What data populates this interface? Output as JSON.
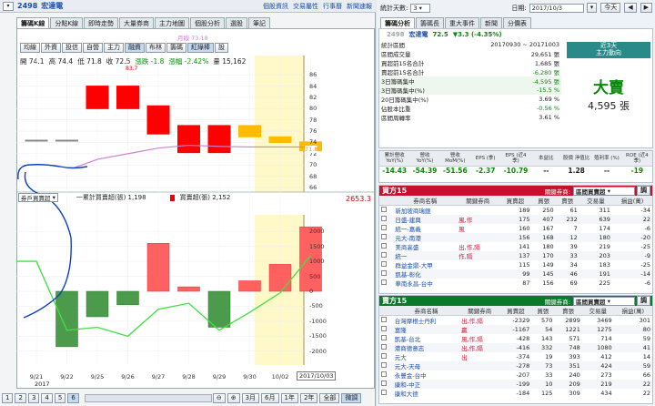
{
  "stock": {
    "code": "2498",
    "name": "宏達電",
    "price": "72.5",
    "change": "▼3.3 (-4.35%)"
  },
  "top_links": [
    "個股資訊",
    "交易屬性",
    "行事曆",
    "新聞速報"
  ],
  "left_tabs": [
    "籌碼K線",
    "分點K線",
    "即時走勢",
    "大量券商",
    "主力地圖",
    "個股分析",
    "選股",
    "筆記"
  ],
  "chart_buttons": [
    "均線",
    "外資",
    "投信",
    "自營",
    "主力",
    "融資",
    "布林",
    "籌碼",
    "紅綠棒",
    "設"
  ],
  "ohlc": {
    "open": "開 74.1",
    "high": "高 74.4",
    "low": "低 71.8",
    "close": "收 72.5",
    "chg": "漲跌 -1.8",
    "pct": "漲幅 -2.42%",
    "vol": "量 15,162"
  },
  "ma_label": "月線 73.18",
  "upper_marks": {
    "price_high": "83.7",
    "price_low": "71.8"
  },
  "price_axis": [
    "86",
    "84",
    "82",
    "80",
    "78",
    "76",
    "74",
    "72",
    "70",
    "68",
    "66"
  ],
  "lower_header": {
    "select": "券戶買賣超",
    "series1": "一累計買賣超(張) 1,198",
    "series2": "買賣超(張) 2,152",
    "right_value": "2653.3"
  },
  "lower_axis": [
    "2000",
    "1500",
    "1000",
    "500",
    "0",
    "-500",
    "-1000",
    "-1500",
    "-2000"
  ],
  "chart_data": {
    "type": "bar",
    "categories": [
      "9/21",
      "9/22",
      "9/25",
      "9/26",
      "9/27",
      "9/28",
      "9/29",
      "9/30",
      "10/02",
      "10/03"
    ],
    "candles": [
      {
        "o": 74.4,
        "c": 74.4
      },
      {
        "o": 74.4,
        "c": 74.4
      },
      {
        "o": 80,
        "c": 84
      },
      {
        "o": 80,
        "c": 84
      },
      {
        "o": 75.5,
        "c": 80.5
      },
      {
        "o": 72.2,
        "c": 77
      },
      {
        "o": 72.2,
        "c": 77
      },
      {
        "o": 77,
        "c": 75
      },
      {
        "o": 75,
        "c": 74
      },
      {
        "o": 74.1,
        "c": 72.5
      }
    ],
    "candle_colors": [
      "#888888",
      "#888888",
      "#ff0000",
      "#ff0000",
      "#ff0000",
      "#ff0000",
      "#ff0000",
      "#ffbb00",
      "#ffbb00",
      "#ffbb00"
    ],
    "ma": [
      null,
      null,
      71,
      72,
      73,
      73.5,
      73.3,
      73.2,
      73.2,
      73.18
    ],
    "ylim_price": [
      66,
      87
    ],
    "net_buy": [
      0,
      -1850,
      -850,
      -450,
      1600,
      150,
      -1200,
      350,
      900,
      2152
    ],
    "cumulative": [
      1000,
      -1300,
      -1200,
      -1500,
      -600,
      -400,
      -1300,
      -700,
      -50,
      1198
    ],
    "ylim_vol": [
      -2400,
      2400
    ],
    "xlabel_year": "2017",
    "selected_date": "2017/10/03"
  },
  "bottom_bar": {
    "pages": [
      "1",
      "2",
      "3",
      "4",
      "5",
      "6"
    ],
    "active_page": "6",
    "ranges": [
      "3月",
      "6月",
      "1年",
      "2年",
      "全部",
      "微調"
    ]
  },
  "right_top": {
    "days_label": "統計天數:",
    "days_value": "3",
    "date_label": "日期:",
    "date_value": "2017/10/3",
    "today_btn": "今天"
  },
  "right_tabs": [
    "籌碼分析",
    "籌碼長",
    "重大事件",
    "新聞",
    "分價表"
  ],
  "stats": {
    "rows": [
      {
        "label": "統計區間",
        "value": "20170930 ~ 20171003"
      },
      {
        "label": "區間成交量",
        "value": "29,651 張"
      },
      {
        "label": "買超前15名合計",
        "value": "1,685 張"
      },
      {
        "label": "賣超前15名合計",
        "value": "-6,280 張"
      },
      {
        "label": "3日籌碼集中",
        "value": "-4,595 張"
      },
      {
        "label": "3日籌碼集中(%)",
        "value": "-15.5 %"
      },
      {
        "label": "20日籌碼集中(%)",
        "value": "3.69 %"
      },
      {
        "label": "佔股本比重",
        "value": "-0.56 %"
      },
      {
        "label": "區間周轉率",
        "value": "3.61 %"
      }
    ],
    "trend_title": "近3天",
    "trend_sub": "主力動向",
    "verdict": "大賣",
    "verdict_amt": "4,595 張"
  },
  "fund": {
    "headers": [
      "累計營收 YoY(%)",
      "營收 YoY(%)",
      "營收 MoM(%)",
      "EPS (季)",
      "EPS (近4季)",
      "本益比",
      "股價 淨值比",
      "殖利率 (%)",
      "ROE (近4季)"
    ],
    "values": [
      "-14.43",
      "-54.39",
      "-51.56",
      "-2.37",
      "-10.79",
      "--",
      "1.28",
      "--",
      "-19"
    ]
  },
  "buy_section": {
    "title": "買方15",
    "hint": "關鍵券商:",
    "select": "區間買賣超",
    "btn": "調",
    "headers": [
      "券商名稱",
      "關鍵券商",
      "買賣超",
      "買張",
      "賣張",
      "交易量",
      "損益(萬)"
    ],
    "rows": [
      {
        "name": "新加坡商瑞銀",
        "key": "",
        "net": "189",
        "buy": "250",
        "sell": "61",
        "vol": "311",
        "pl": "-34"
      },
      {
        "name": "日盛-建興",
        "key": "風,作",
        "net": "175",
        "buy": "407",
        "sell": "232",
        "vol": "639",
        "pl": "22"
      },
      {
        "name": "統一-嘉義",
        "key": "風",
        "net": "160",
        "buy": "167",
        "sell": "7",
        "vol": "174",
        "pl": "-6"
      },
      {
        "name": "元大-南港",
        "key": "",
        "net": "156",
        "buy": "168",
        "sell": "12",
        "vol": "180",
        "pl": "-20"
      },
      {
        "name": "美商高盛",
        "key": "出,作,隔",
        "net": "141",
        "buy": "180",
        "sell": "39",
        "vol": "219",
        "pl": "-25"
      },
      {
        "name": "統一",
        "key": "作,隔",
        "net": "137",
        "buy": "170",
        "sell": "33",
        "vol": "203",
        "pl": "-9"
      },
      {
        "name": "群益金鼎-大甲",
        "key": "",
        "net": "115",
        "buy": "149",
        "sell": "34",
        "vol": "183",
        "pl": "-25"
      },
      {
        "name": "凱基-彰化",
        "key": "",
        "net": "99",
        "buy": "145",
        "sell": "46",
        "vol": "191",
        "pl": "-14"
      },
      {
        "name": "華南永昌-台中",
        "key": "",
        "net": "87",
        "buy": "156",
        "sell": "69",
        "vol": "225",
        "pl": "-6"
      }
    ]
  },
  "sell_section": {
    "title": "賣方15",
    "hint": "關鍵券商:",
    "select": "區間買賣超",
    "btn": "調",
    "headers": [
      "券商名稱",
      "關鍵券商",
      "買賣超",
      "買張",
      "賣張",
      "交易量",
      "損益(萬)"
    ],
    "rows": [
      {
        "name": "台灣摩根士丹利",
        "key": "出,作,隔",
        "net": "-2329",
        "buy": "570",
        "sell": "2899",
        "vol": "3469",
        "pl": "301"
      },
      {
        "name": "富隆",
        "key": "贏",
        "net": "-1167",
        "buy": "54",
        "sell": "1221",
        "vol": "1275",
        "pl": "80"
      },
      {
        "name": "凱基-台北",
        "key": "風,作,隔",
        "net": "-428",
        "buy": "143",
        "sell": "571",
        "vol": "714",
        "pl": "59"
      },
      {
        "name": "港商德意志",
        "key": "出,作,隔",
        "net": "-416",
        "buy": "332",
        "sell": "748",
        "vol": "1080",
        "pl": "41"
      },
      {
        "name": "元大",
        "key": "出",
        "net": "-374",
        "buy": "19",
        "sell": "393",
        "vol": "412",
        "pl": "14"
      },
      {
        "name": "元大-天母",
        "key": "",
        "net": "-278",
        "buy": "73",
        "sell": "351",
        "vol": "424",
        "pl": "59"
      },
      {
        "name": "永豐金-台中",
        "key": "",
        "net": "-207",
        "buy": "33",
        "sell": "240",
        "vol": "273",
        "pl": "66"
      },
      {
        "name": "康和-中正",
        "key": "",
        "net": "-199",
        "buy": "10",
        "sell": "209",
        "vol": "219",
        "pl": "22"
      },
      {
        "name": "康和大德",
        "key": "",
        "net": "-184",
        "buy": "125",
        "sell": "309",
        "vol": "434",
        "pl": "22"
      }
    ]
  }
}
